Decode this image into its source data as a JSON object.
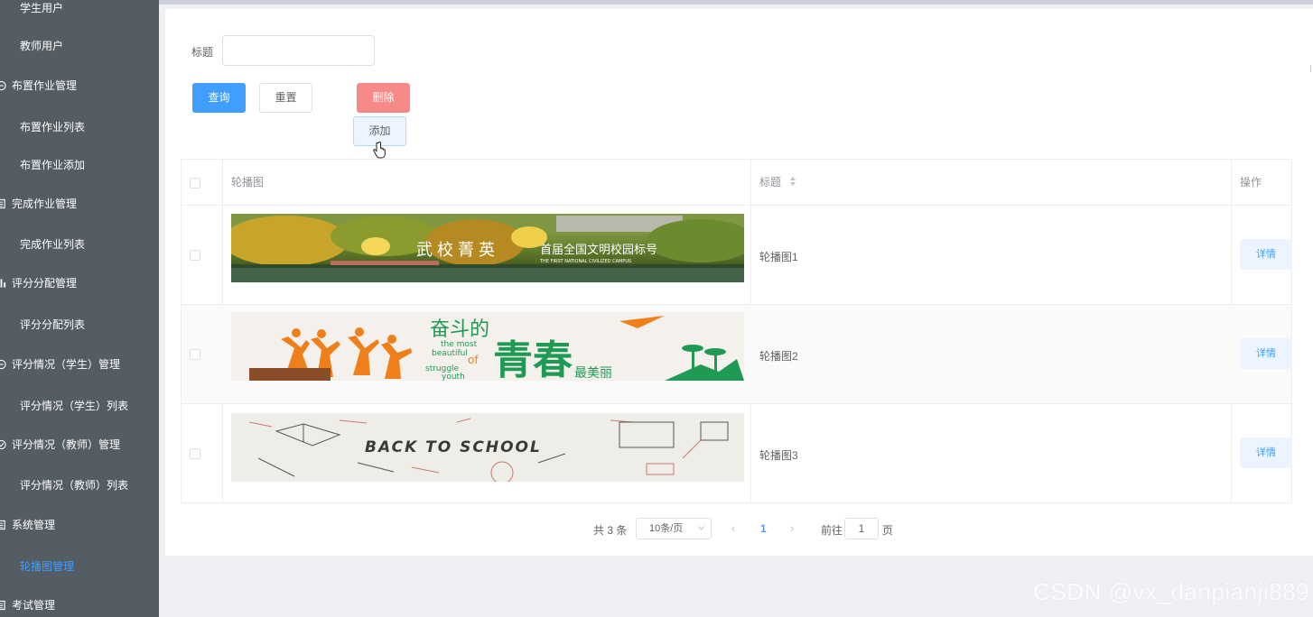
{
  "sidebar": {
    "items": [
      {
        "label": "学生用户",
        "type": "sub"
      },
      {
        "label": "教师用户",
        "type": "sub"
      },
      {
        "label": "布置作业管理",
        "type": "group",
        "icon": "chat-icon"
      },
      {
        "label": "布置作业列表",
        "type": "sub"
      },
      {
        "label": "布置作业添加",
        "type": "sub"
      },
      {
        "label": "完成作业管理",
        "type": "group",
        "icon": "list-icon"
      },
      {
        "label": "完成作业列表",
        "type": "sub"
      },
      {
        "label": "评分分配管理",
        "type": "group",
        "icon": "chart-icon"
      },
      {
        "label": "评分分配列表",
        "type": "sub"
      },
      {
        "label": "评分情况（学生）管理",
        "type": "group",
        "icon": "chat-icon"
      },
      {
        "label": "评分情况（学生）列表",
        "type": "sub"
      },
      {
        "label": "评分情况（教师）管理",
        "type": "group",
        "icon": "check-circle-icon"
      },
      {
        "label": "评分情况（教师）列表",
        "type": "sub"
      },
      {
        "label": "系统管理",
        "type": "group",
        "icon": "list-icon"
      },
      {
        "label": "轮播图管理",
        "type": "sub",
        "active": true
      },
      {
        "label": "考试管理",
        "type": "group",
        "icon": "list-icon"
      }
    ]
  },
  "search": {
    "title_label": "标题",
    "title_value": "",
    "title_placeholder": ""
  },
  "toolbar": {
    "query_label": "查询",
    "reset_label": "重置",
    "delete_label": "删除",
    "add_label": "添加"
  },
  "table": {
    "headers": {
      "image": "轮播图",
      "title": "标题",
      "actions": "操作"
    },
    "rows": [
      {
        "title": "轮播图1",
        "detail_label": "详情",
        "banner_text": "武校菁英",
        "banner_subtext": "首届全国文明校园标号",
        "banner_caption": "THE FIRST NATIONAL CIVILIZED CAMPUS"
      },
      {
        "title": "轮播图2",
        "detail_label": "详情",
        "banner_text_top": "奋斗的",
        "banner_text_main": "青春",
        "banner_text_side": "最美丽",
        "banner_text_en1": "the most",
        "banner_text_en2": "beautiful",
        "banner_text_en3": "of",
        "banner_text_en4": "struggle",
        "banner_text_en5": "youth"
      },
      {
        "title": "轮播图3",
        "detail_label": "详情",
        "banner_text": "BACK TO SCHOOL"
      }
    ]
  },
  "pagination": {
    "total_text": "共 3 条",
    "page_size": "10条/页",
    "current_page": "1",
    "goto_label": "前往",
    "jump_value": "1",
    "page_unit": "页",
    "prev_symbol": "‹",
    "next_symbol": "›"
  },
  "watermark": "CSDN @vx_danpianji889",
  "colors": {
    "sidebar_bg": "#545c64",
    "primary": "#409eff",
    "danger": "#f78989",
    "panel_bg": "#ffffff",
    "page_bg": "#eef0f4"
  }
}
